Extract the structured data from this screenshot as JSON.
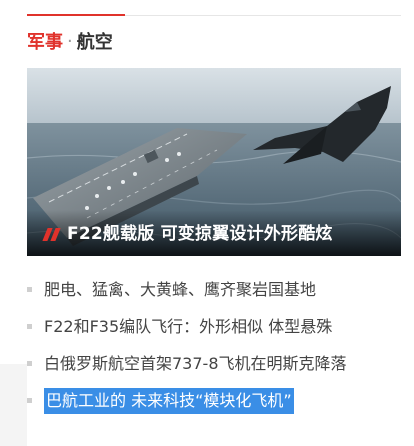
{
  "section": {
    "category": "军事",
    "separator": "·",
    "subcategory": "航空"
  },
  "hero": {
    "caption": "F22舰载版 可变掠翼设计外形酷炫"
  },
  "news": [
    {
      "title": "肥电、猛禽、大黄蜂、鹰齐聚岩国基地",
      "highlighted": false
    },
    {
      "title": "F22和F35编队飞行：外形相似 体型悬殊",
      "highlighted": false
    },
    {
      "title": "白俄罗斯航空首架737-8飞机在明斯克降落",
      "highlighted": false
    },
    {
      "title": "巴航工业的 未来科技“模块化飞机”",
      "highlighted": true
    }
  ],
  "colors": {
    "accent": "#e0322b",
    "highlight": "#3a8ee6"
  }
}
